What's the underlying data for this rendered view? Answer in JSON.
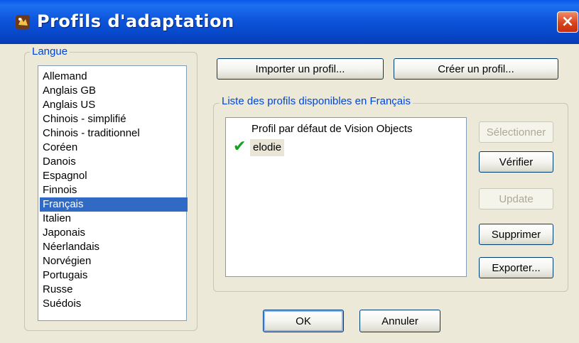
{
  "window": {
    "title": "Profils d'adaptation",
    "close_label": "×"
  },
  "language_group": {
    "label": "Langue",
    "items": [
      "Allemand",
      "Anglais GB",
      "Anglais US",
      "Chinois - simplifié",
      "Chinois - traditionnel",
      "Coréen",
      "Danois",
      "Espagnol",
      "Finnois",
      "Français",
      "Italien",
      "Japonais",
      "Néerlandais",
      "Norvégien",
      "Portugais",
      "Russe",
      "Suédois"
    ],
    "selected": "Français"
  },
  "top_buttons": {
    "import_label": "Importer un profil...",
    "create_label": "Créer un profil..."
  },
  "profiles_group": {
    "label": "Liste des profils disponibles en Français",
    "profiles": [
      {
        "name": "Profil par défaut de Vision Objects",
        "active": false
      },
      {
        "name": "elodie",
        "active": true
      }
    ],
    "buttons": {
      "select_label": "Sélectionner",
      "verify_label": "Vérifier",
      "update_label": "Update",
      "delete_label": "Supprimer",
      "export_label": "Exporter..."
    }
  },
  "footer": {
    "ok_label": "OK",
    "cancel_label": "Annuler"
  },
  "colors": {
    "titlebar": "#0a58e8",
    "selection": "#316ac5",
    "group_label": "#0046d5",
    "checkmark": "#13a31e"
  }
}
